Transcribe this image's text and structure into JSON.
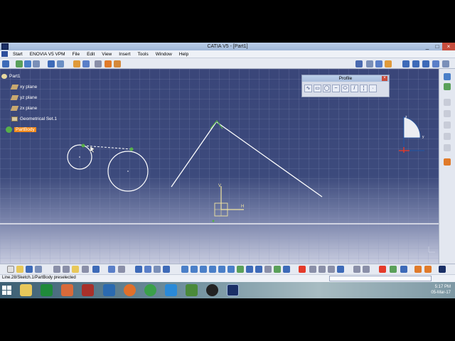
{
  "window": {
    "title": "CATIA V5 - [Part1]",
    "controls": [
      "_",
      "□",
      "×"
    ]
  },
  "menu": [
    "Start",
    "ENOVIA V5 VPM",
    "File",
    "Edit",
    "View",
    "Insert",
    "Tools",
    "Window",
    "Help"
  ],
  "tree": {
    "root": "Part1",
    "items": [
      {
        "label": "xy plane",
        "icon": "plane-icon"
      },
      {
        "label": "yz plane",
        "icon": "plane-icon"
      },
      {
        "label": "zx plane",
        "icon": "plane-icon"
      },
      {
        "label": "Geometrical Set.1",
        "icon": "geometrical-set-icon"
      },
      {
        "label": "PartBody",
        "icon": "partbody-icon",
        "selected": true
      }
    ]
  },
  "profile_toolbar": {
    "title": "Profile",
    "close": "×",
    "tools": [
      "profile-icon",
      "rectangle-icon",
      "circle-icon",
      "spline-icon",
      "ellipse-icon",
      "line-icon",
      "axis-icon",
      "point-icon"
    ]
  },
  "compass": {
    "axis_x": "x",
    "axis_y": "y",
    "axis_z": "z"
  },
  "sketch_axes": {
    "h_label": "H",
    "v_label": "V"
  },
  "status": {
    "message": "Line.28/Sketch.1/PartBody preselected"
  },
  "taskbar": {
    "time": "5:17 PM",
    "date": "05-Mar-17",
    "apps": [
      "file-explorer-icon",
      "excel-icon",
      "app-icon",
      "store-icon",
      "firefox-icon",
      "chrome-icon",
      "ie-icon",
      "app-icon",
      "app-icon",
      "catia-icon"
    ]
  },
  "colors": {
    "viewport_top": "#3a4679",
    "selection": "#f28a1c",
    "sketch_white": "#ffffff",
    "profile_green": "#57b04a",
    "compass_blue": "#1f56a6"
  }
}
